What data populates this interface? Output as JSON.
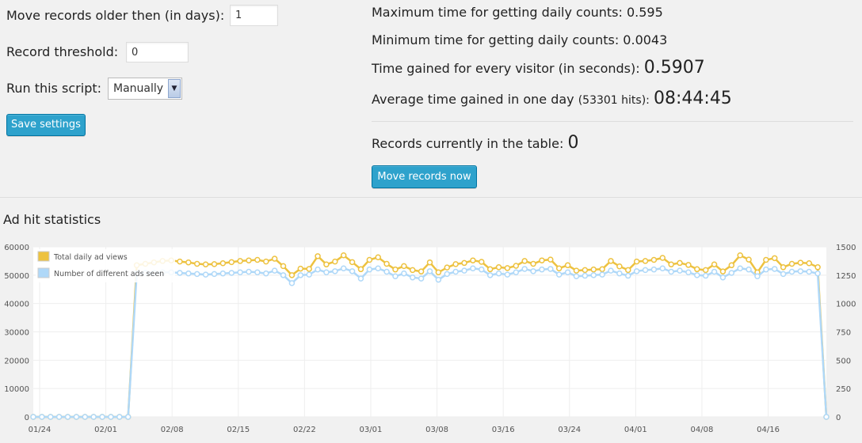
{
  "settings": {
    "older_label": "Move records older then (in days):",
    "older_value": "1",
    "threshold_label": "Record threshold:",
    "threshold_value": "0",
    "run_label": "Run this script:",
    "run_value": "Manually",
    "save_label": "Save settings"
  },
  "stats": {
    "max_label": "Maximum time for getting daily counts:",
    "max_value": "0.595",
    "min_label": "Minimum time for getting daily counts:",
    "min_value": "0.0043",
    "gain_label": "Time gained for every visitor (in seconds):",
    "gain_value": "0.5907",
    "avg_label": "Average time gained in one day",
    "avg_hits": "(53301 hits):",
    "avg_value": "08:44:45",
    "records_label": "Records currently in the table:",
    "records_value": "0",
    "move_label": "Move records now"
  },
  "section_title": "Ad hit statistics",
  "chart_data": {
    "type": "line",
    "title": "",
    "x_ticks": [
      "01/24",
      "02/01",
      "02/08",
      "02/15",
      "02/22",
      "03/01",
      "03/08",
      "03/16",
      "03/24",
      "04/01",
      "04/08",
      "04/16"
    ],
    "x_start_label": "01/24",
    "n_days": 93,
    "y_left": {
      "ticks": [
        0,
        10000,
        20000,
        30000,
        40000,
        50000,
        60000
      ],
      "ylim": [
        0,
        60000
      ]
    },
    "y_right": {
      "ticks": [
        0,
        250,
        500,
        750,
        1000,
        1250,
        1500
      ],
      "ylim": [
        0,
        1500
      ]
    },
    "legend": {
      "position": "top-left",
      "entries": [
        "Total daily ad views",
        "Number of different ads seen"
      ]
    },
    "colors": {
      "views": "#edc240",
      "ads": "#afd8f8"
    },
    "series": [
      {
        "name": "Total daily ad views",
        "axis": "left",
        "values": [
          0,
          0,
          0,
          0,
          0,
          0,
          0,
          0,
          0,
          0,
          0,
          0,
          53500,
          54000,
          54500,
          55000,
          55200,
          54800,
          54500,
          54000,
          53800,
          53900,
          54200,
          54600,
          55000,
          55200,
          55400,
          54800,
          55800,
          53200,
          50000,
          52300,
          52200,
          56700,
          53800,
          54800,
          57000,
          54600,
          52100,
          55400,
          56300,
          54000,
          52000,
          53200,
          51800,
          51300,
          54500,
          51000,
          52700,
          53900,
          54300,
          55200,
          54700,
          52100,
          52800,
          52500,
          53300,
          55000,
          54000,
          55200,
          55500,
          52400,
          53500,
          51600,
          51800,
          52000,
          52100,
          55000,
          53100,
          51800,
          54800,
          55000,
          55400,
          56100,
          53800,
          54300,
          53600,
          52100,
          51800,
          53800,
          51300,
          53500,
          57000,
          55500,
          51000,
          55400,
          56000,
          52800,
          54000,
          54400,
          54200,
          52800,
          0
        ]
      },
      {
        "name": "Number of different ads seen",
        "axis": "right",
        "values": [
          0,
          0,
          0,
          0,
          0,
          0,
          0,
          0,
          0,
          0,
          0,
          0,
          1265,
          1270,
          1270,
          1275,
          1275,
          1270,
          1265,
          1260,
          1255,
          1260,
          1265,
          1270,
          1275,
          1280,
          1275,
          1265,
          1290,
          1250,
          1180,
          1250,
          1255,
          1300,
          1275,
          1285,
          1310,
          1285,
          1220,
          1300,
          1310,
          1280,
          1240,
          1265,
          1230,
          1220,
          1285,
          1210,
          1260,
          1280,
          1290,
          1310,
          1300,
          1250,
          1265,
          1255,
          1275,
          1305,
          1285,
          1300,
          1305,
          1255,
          1275,
          1240,
          1245,
          1250,
          1255,
          1290,
          1265,
          1245,
          1285,
          1295,
          1300,
          1310,
          1280,
          1290,
          1275,
          1250,
          1245,
          1280,
          1230,
          1270,
          1310,
          1300,
          1240,
          1300,
          1305,
          1260,
          1280,
          1285,
          1280,
          1265,
          0
        ]
      }
    ]
  }
}
